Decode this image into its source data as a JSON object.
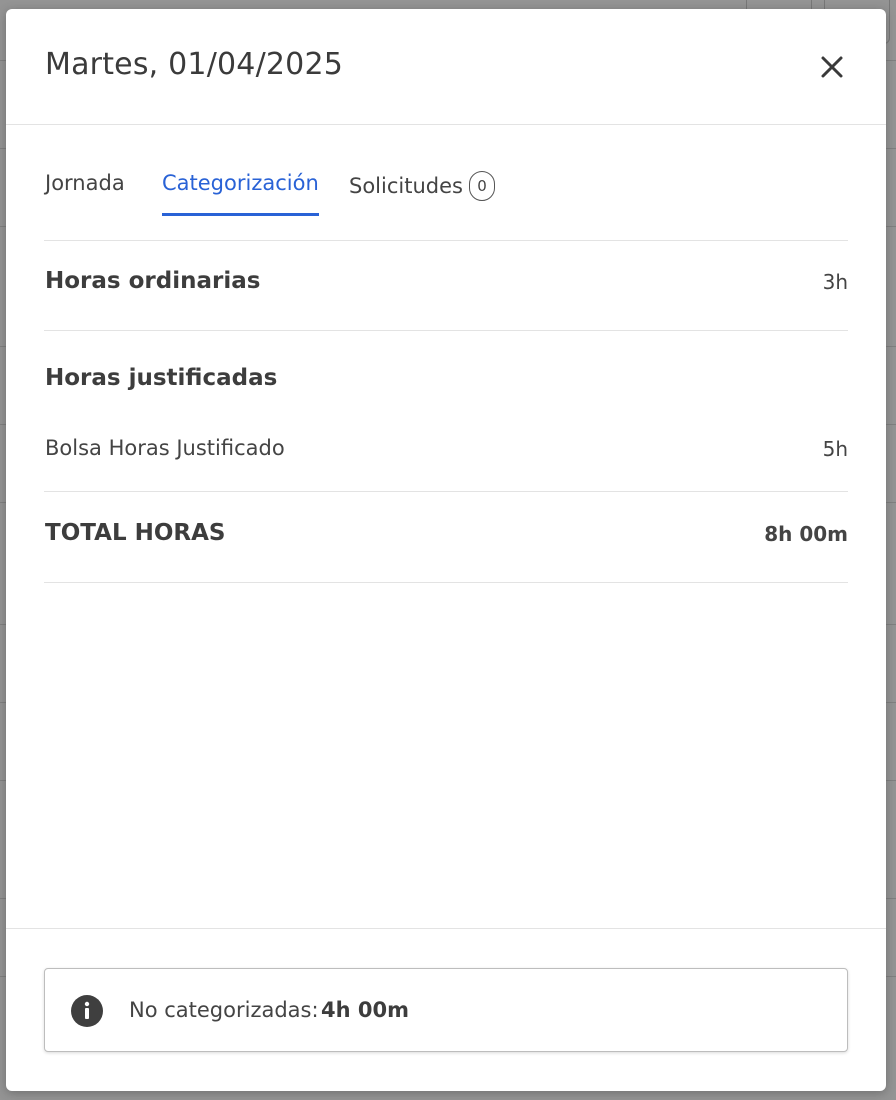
{
  "modal": {
    "title": "Martes, 01/04/2025",
    "tabs": [
      {
        "label": "Jornada"
      },
      {
        "label": "Categorización"
      },
      {
        "label": "Solicitudes",
        "badge": "0"
      }
    ],
    "sections": {
      "ordinary": {
        "label": "Horas ordinarias",
        "value": "3h"
      },
      "justified": {
        "label": "Horas justificadas",
        "items": [
          {
            "label": "Bolsa Horas Justificado",
            "value": "5h"
          }
        ]
      },
      "total": {
        "label": "TOTAL HORAS",
        "value": "8h 00m"
      }
    },
    "footer": {
      "info_label": "No categorizadas:",
      "info_value": "4h 00m"
    }
  },
  "colors": {
    "accent": "#2962d6",
    "overlay": "rgba(0,0,0,0.42)"
  }
}
